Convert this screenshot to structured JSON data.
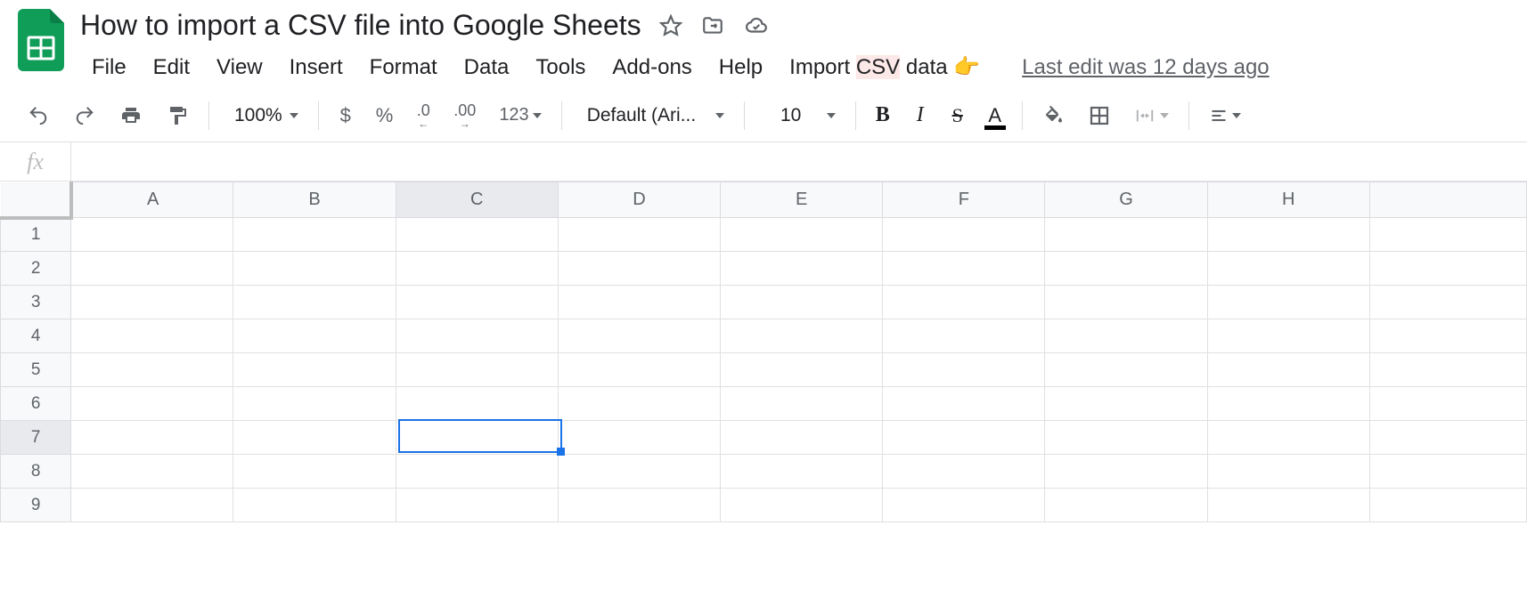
{
  "doc": {
    "title": "How to import a CSV file into Google Sheets"
  },
  "menu": {
    "file": "File",
    "edit": "Edit",
    "view": "View",
    "insert": "Insert",
    "format": "Format",
    "data": "Data",
    "tools": "Tools",
    "addons": "Add-ons",
    "help": "Help",
    "import_csv_pre": "Import ",
    "import_csv_hl": "CSV",
    "import_csv_post": " data 👉",
    "last_edit": "Last edit was 12 days ago"
  },
  "toolbar": {
    "zoom": "100%",
    "currency": "$",
    "percent": "%",
    "dec_dec": ".0",
    "inc_dec": ".00",
    "more_formats": "123",
    "font": "Default (Ari...",
    "font_size": "10",
    "bold": "B",
    "italic": "I",
    "strike": "S",
    "text_color": "A"
  },
  "fx": {
    "label": "fx",
    "value": ""
  },
  "grid": {
    "cols": [
      "A",
      "B",
      "C",
      "D",
      "E",
      "F",
      "G",
      "H",
      ""
    ],
    "rows": [
      "1",
      "2",
      "3",
      "4",
      "5",
      "6",
      "7",
      "8",
      "9"
    ],
    "selected_col_index": 2,
    "selected_row_index": 6
  }
}
